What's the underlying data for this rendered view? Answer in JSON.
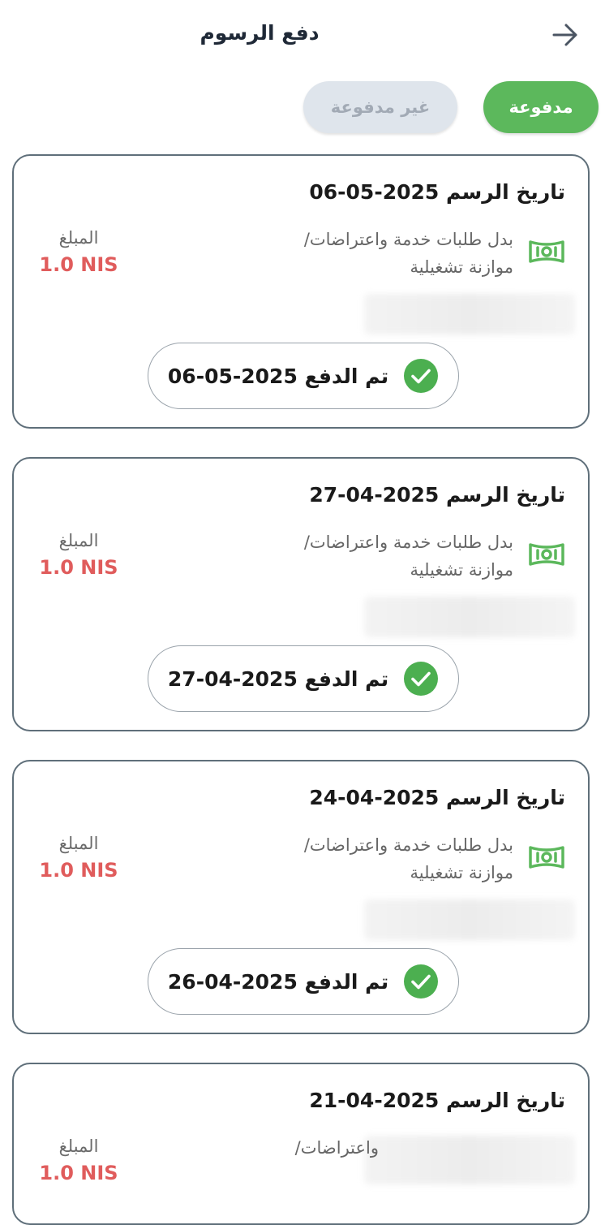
{
  "header": {
    "title": "دفع الرسوم",
    "back_icon": "arrow-right-icon"
  },
  "tabs": [
    {
      "label": "مدفوعة",
      "active": true
    },
    {
      "label": "غير مدفوعة",
      "active": false
    }
  ],
  "colors": {
    "accent_green": "#5cb85c",
    "amount_red": "#e05c5c",
    "tab_inactive_bg": "#dfe5ec",
    "card_border": "#5f6f7a"
  },
  "cards": [
    {
      "date": "تاريخ الرسم 2025-05-06",
      "icon": "money-bill-icon",
      "desc_line1": "بدل طلبات خدمة واعتراضات/",
      "desc_line2": "موازنة تشغيلية",
      "amount_label": "المبلغ",
      "amount_value": "1.0 NIS",
      "paid_text": "تم الدفع 2025-05-06"
    },
    {
      "date": "تاريخ الرسم 2025-04-27",
      "icon": "money-bill-icon",
      "desc_line1": "بدل طلبات خدمة واعتراضات/",
      "desc_line2": "موازنة تشغيلية",
      "amount_label": "المبلغ",
      "amount_value": "1.0 NIS",
      "paid_text": "تم الدفع 2025-04-27"
    },
    {
      "date": "تاريخ الرسم 2025-04-24",
      "icon": "money-bill-icon",
      "desc_line1": "بدل طلبات خدمة واعتراضات/",
      "desc_line2": "موازنة تشغيلية",
      "amount_label": "المبلغ",
      "amount_value": "1.0 NIS",
      "paid_text": "تم الدفع 2025-04-26"
    },
    {
      "date": "تاريخ الرسم 2025-04-21",
      "icon": "money-bill-icon",
      "desc_line1": "واعتراضات/",
      "amount_label": "المبلغ",
      "amount_value": "1.0 NIS"
    }
  ]
}
